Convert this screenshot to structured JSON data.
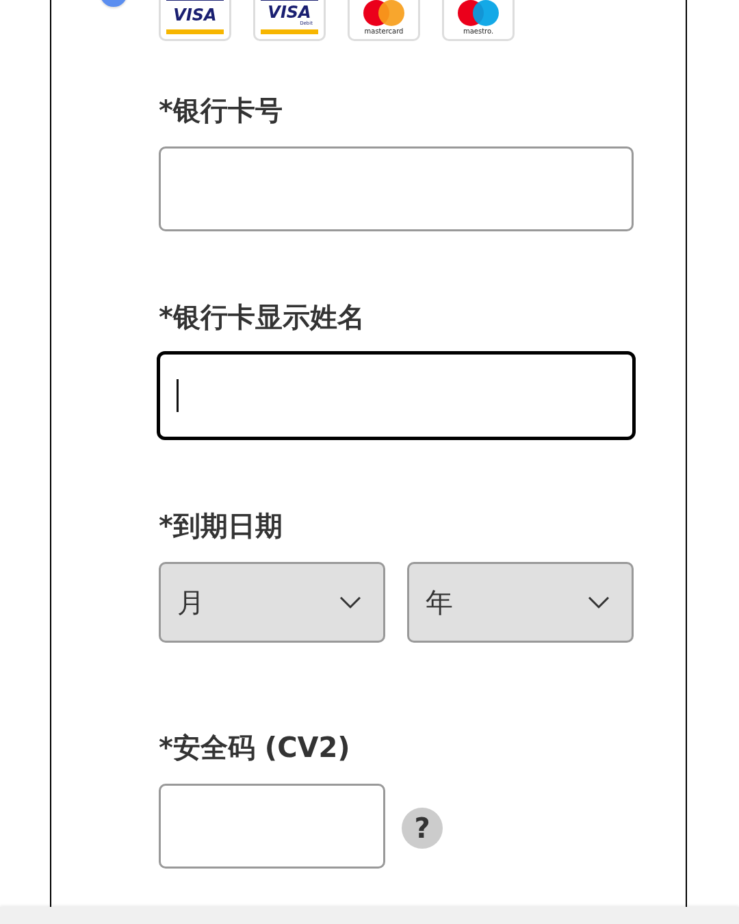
{
  "option_radio": {
    "selected": true
  },
  "payment_methods": [
    {
      "kind": "visa",
      "label": "VISA"
    },
    {
      "kind": "visa",
      "label": "VISA",
      "sublabel": "Debit"
    },
    {
      "kind": "mastercard",
      "label": "mastercard"
    },
    {
      "kind": "maestro",
      "label": "maestro."
    }
  ],
  "fields": [
    {
      "kind": "text",
      "label": "*银行卡号",
      "focused": false
    },
    {
      "kind": "text",
      "label": "*银行卡显示姓名",
      "focused": true
    },
    {
      "kind": "expiry",
      "label": "*到期日期",
      "selects": [
        {
          "placeholder": "月"
        },
        {
          "placeholder": "年"
        }
      ]
    },
    {
      "kind": "cvv",
      "label": "*安全码 (CV2)",
      "focused": false,
      "help": "?"
    }
  ]
}
